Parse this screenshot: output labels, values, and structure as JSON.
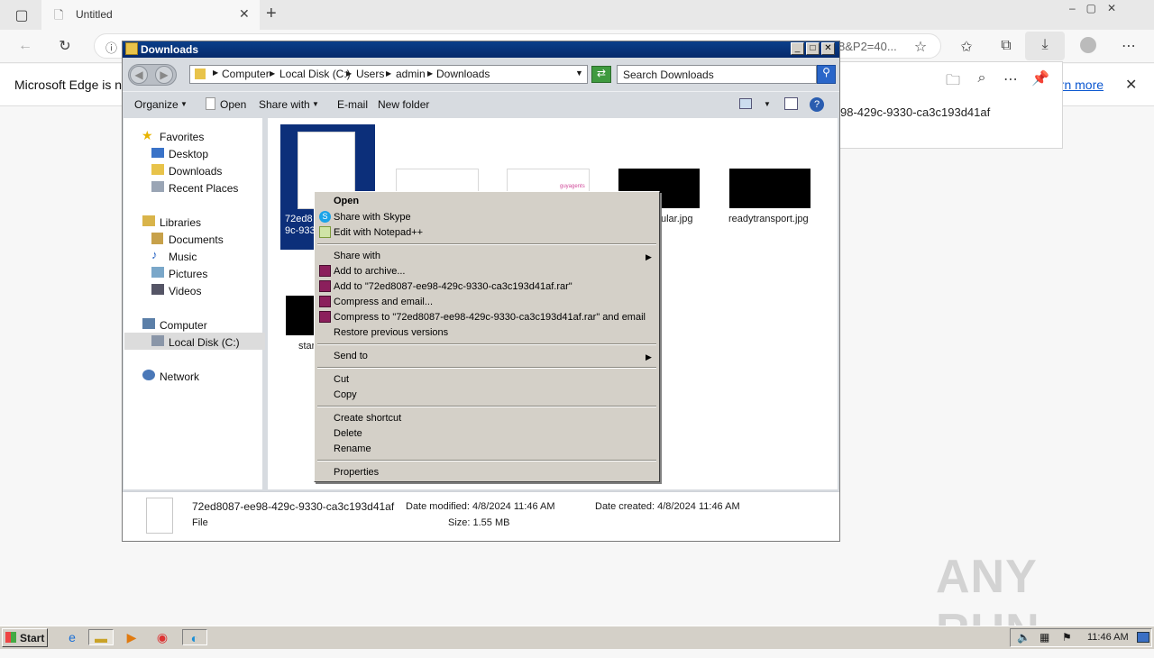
{
  "edge": {
    "tab_title": "Untitled",
    "url_tail": "8&P2=40...",
    "info_text": "Microsoft Edge is no",
    "learn_more": "arn more",
    "download_item": "98-429c-9330-ca3c193d41af"
  },
  "explorer": {
    "title": "Downloads",
    "breadcrumb": [
      "Computer",
      "Local Disk (C:)",
      "Users",
      "admin",
      "Downloads"
    ],
    "search_placeholder": "Search Downloads",
    "commands": {
      "organize": "Organize",
      "open": "Open",
      "share_with": "Share with",
      "email": "E-mail",
      "new_folder": "New folder"
    },
    "nav": {
      "favorites": "Favorites",
      "desktop": "Desktop",
      "downloads": "Downloads",
      "recent": "Recent Places",
      "libraries": "Libraries",
      "documents": "Documents",
      "music": "Music",
      "pictures": "Pictures",
      "videos": "Videos",
      "computer": "Computer",
      "local_disk": "Local Disk (C:)",
      "network": "Network"
    },
    "files": {
      "selected_label_1": "72ed8",
      "selected_label_2": "9c-933",
      "thumb_text_1": "guyagents",
      "file_4": "ular.jpg",
      "file_5": "readytransport.jpg",
      "file_6": "star"
    },
    "details": {
      "name": "72ed8087-ee98-429c-9330-ca3c193d41af",
      "type": "File",
      "modified": "Date modified: 4/8/2024 11:46 AM",
      "created": "Date created: 4/8/2024 11:46 AM",
      "size": "Size: 1.55 MB"
    }
  },
  "context_menu": {
    "open": "Open",
    "skype": "Share with Skype",
    "notepad": "Edit with Notepad++",
    "share_with": "Share with",
    "add_archive": "Add to archive...",
    "add_rar": "Add to \"72ed8087-ee98-429c-9330-ca3c193d41af.rar\"",
    "compress_email": "Compress and email...",
    "compress_rar_email": "Compress to \"72ed8087-ee98-429c-9330-ca3c193d41af.rar\" and email",
    "restore": "Restore previous versions",
    "send_to": "Send to",
    "cut": "Cut",
    "copy": "Copy",
    "shortcut": "Create shortcut",
    "delete": "Delete",
    "rename": "Rename",
    "properties": "Properties"
  },
  "taskbar": {
    "start": "Start",
    "clock": "11:46 AM"
  },
  "watermark": "ANY RUN"
}
